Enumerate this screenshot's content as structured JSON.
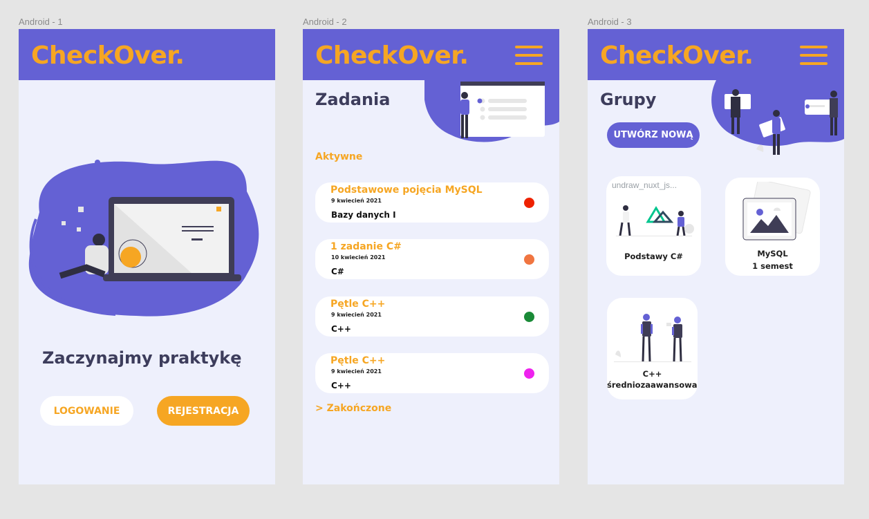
{
  "frames": {
    "one": "Android - 1",
    "two": "Android - 2",
    "three": "Android - 3"
  },
  "app": {
    "brand": "CheckOver."
  },
  "screen1": {
    "headline": "Zaczynajmy praktykę",
    "login_label": "LOGOWANIE",
    "register_label": "REJESTRACJA"
  },
  "screen2": {
    "title": "Zadania",
    "active_label": "Aktywne",
    "tasks": [
      {
        "title": "Podstawowe pojęcia MySQL",
        "date": "9 kwiecień 2021",
        "course": "Bazy danych I",
        "status_color": "#ee2200"
      },
      {
        "title": "1 zadanie C#",
        "date": "10 kwiecień 2021",
        "course": "C#",
        "status_color": "#f07540"
      },
      {
        "title": "Pętle C++",
        "date": "9 kwiecień 2021",
        "course": "C++",
        "status_color": "#1a8a37"
      },
      {
        "title": "Pętle C++",
        "date": "9 kwiecień 2021",
        "course": "C++",
        "status_color": "#ee22ee"
      }
    ],
    "finished_label": "> Zakończone"
  },
  "screen3": {
    "title": "Grupy",
    "create_label": "UTWÓRZ NOWĄ",
    "groups": [
      {
        "name": "Podstawy C#",
        "image_caption": "undraw_nuxt_js..."
      },
      {
        "name_line1": "MySQL",
        "name_line2": "1 semest"
      },
      {
        "name_line1": "C++",
        "name_line2": "średniozaawansowani"
      }
    ]
  },
  "colors": {
    "accent": "#f6a623",
    "primary": "#6461d4",
    "background": "#eef0fc",
    "text_dark": "#3d3d5c"
  }
}
